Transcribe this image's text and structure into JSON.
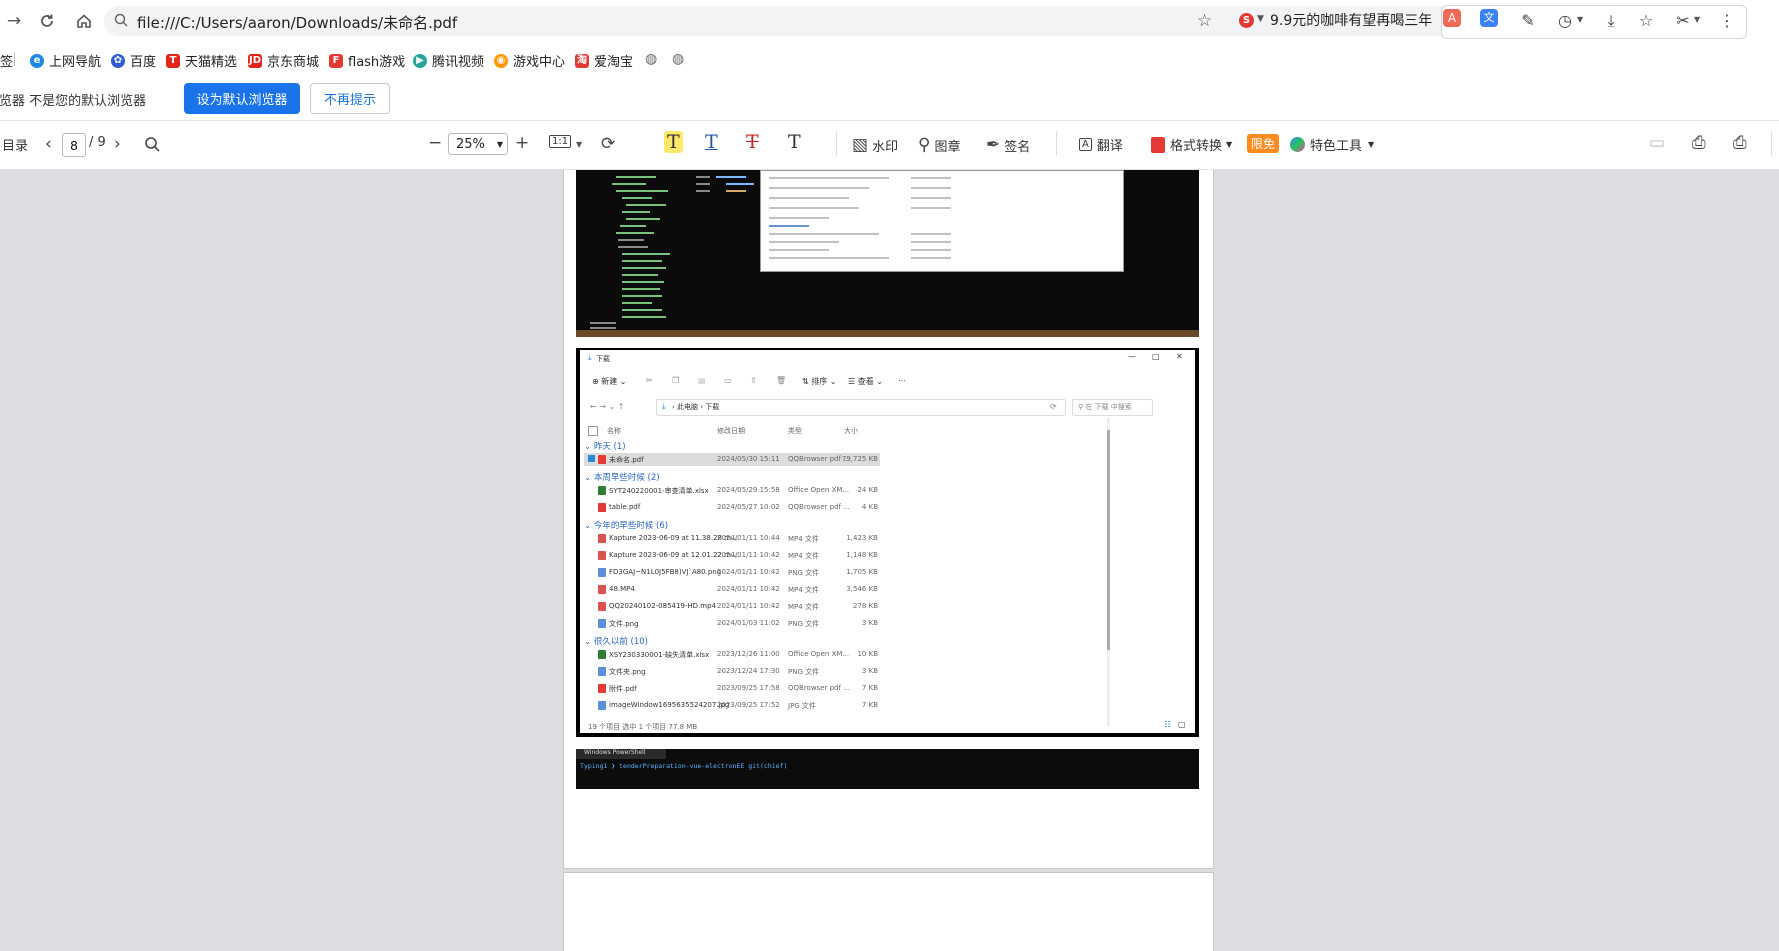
{
  "browser": {
    "url": "file:///C:/Users/aaron/Downloads/未命名.pdf",
    "promo_text": "9.9元的咖啡有望再喝三年"
  },
  "bookmarks": [
    {
      "label": "签",
      "icon": "bookmark-fragment-icon"
    },
    {
      "label": "上网导航",
      "icon": "ie-globe-icon"
    },
    {
      "label": "百度",
      "icon": "baidu-paw-icon"
    },
    {
      "label": "天猫精选",
      "icon": "tmall-icon"
    },
    {
      "label": "京东商城",
      "icon": "jd-icon"
    },
    {
      "label": "flash游戏",
      "icon": "flash-game-icon"
    },
    {
      "label": "腾讯视频",
      "icon": "tencent-video-icon"
    },
    {
      "label": "游戏中心",
      "icon": "game-center-icon"
    },
    {
      "label": "爱淘宝",
      "icon": "ai-taobao-icon"
    }
  ],
  "infobar": {
    "message": "浏览器 不是您的默认浏览器",
    "set_default": "设为默认浏览器",
    "no_remind": "不再提示"
  },
  "pdf_toolbar": {
    "toc": "目录",
    "page_current": "8",
    "page_total": "/ 9",
    "zoom": "25%",
    "fit": "1:1",
    "watermark": "水印",
    "stamp": "图章",
    "sign": "签名",
    "translate": "翻译",
    "convert": "格式转换",
    "limited_free": "限免",
    "special_tools": "特色工具"
  },
  "explorer": {
    "title": "下载",
    "new_label": "新建",
    "sort_label": "排序",
    "view_label": "查看",
    "breadcrumb": [
      "此电脑",
      "下载"
    ],
    "search_placeholder": "在 下载 中搜索",
    "columns": [
      "名称",
      "修改日期",
      "类型",
      "大小"
    ],
    "groups": [
      {
        "label": "昨天 (1)",
        "rows": [
          {
            "name": "未命名.pdf",
            "date": "2024/05/30 15:11",
            "type": "QQBrowser pdf ...",
            "size": "79,725 KB"
          }
        ]
      },
      {
        "label": "本周早些时候 (2)",
        "rows": [
          {
            "name": "SYT240220001-审查清单.xlsx",
            "date": "2024/05/29 15:58",
            "type": "Office Open XM...",
            "size": "24 KB"
          },
          {
            "name": "table.pdf",
            "date": "2024/05/27 10:02",
            "type": "QQBrowser pdf ...",
            "size": "4 KB"
          }
        ]
      },
      {
        "label": "今年的早些时候 (6)",
        "rows": [
          {
            "name": "Kapture 2023-06-09 at 11.38.28.m...",
            "date": "2024/01/11 10:44",
            "type": "MP4 文件",
            "size": "1,423 KB"
          },
          {
            "name": "Kapture 2023-06-09 at 12.01.22.m...",
            "date": "2024/01/11 10:42",
            "type": "MP4 文件",
            "size": "1,148 KB"
          },
          {
            "name": "FD3GAJ~N1L0J5FB8)VJ`A80.png",
            "date": "2024/01/11 10:42",
            "type": "PNG 文件",
            "size": "1,705 KB"
          },
          {
            "name": "48.MP4",
            "date": "2024/01/11 10:42",
            "type": "MP4 文件",
            "size": "3,546 KB"
          },
          {
            "name": "QQ20240102-085419-HD.mp4",
            "date": "2024/01/11 10:42",
            "type": "MP4 文件",
            "size": "278 KB"
          },
          {
            "name": "文件.png",
            "date": "2024/01/03 11:02",
            "type": "PNG 文件",
            "size": "3 KB"
          }
        ]
      },
      {
        "label": "很久以前 (10)",
        "rows": [
          {
            "name": "XSY230330001-缺失清单.xlsx",
            "date": "2023/12/26 11:00",
            "type": "Office Open XM...",
            "size": "10 KB"
          },
          {
            "name": "文件夹.png",
            "date": "2023/12/24 17:30",
            "type": "PNG 文件",
            "size": "3 KB"
          },
          {
            "name": "附件.pdf",
            "date": "2023/09/25 17:58",
            "type": "QQBrowser pdf ...",
            "size": "7 KB"
          },
          {
            "name": "imageWindow1695635524207.jpg",
            "date": "2023/09/25 17:52",
            "type": "JPG 文件",
            "size": "7 KB"
          }
        ]
      }
    ],
    "status": "19 个项目    选中 1 个项目  77.8 MB"
  },
  "powershell": {
    "tab": "Windows PowerShell",
    "prompt": "Typing1 ❯ tenderPreparation-vue-electronEE  git(chief)"
  },
  "colors": {
    "accent": "#1a73e8",
    "highlight": "#ffe86a",
    "orange_badge": "#ff8a1e"
  }
}
